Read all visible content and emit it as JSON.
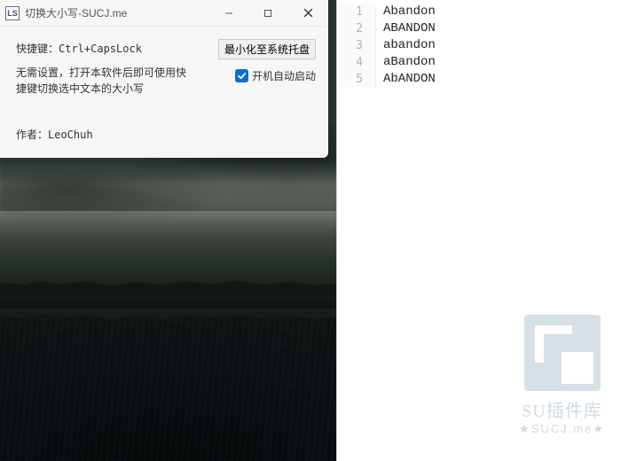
{
  "window": {
    "title": "切换大小写-SUCJ.me",
    "icon_glyph": "LS"
  },
  "body": {
    "hotkey_label": "快捷键：Ctrl+CapsLock",
    "tray_button": "最小化至系统托盘",
    "description_line1": "无需设置，打开本软件后即可使用快",
    "description_line2": "捷键切换选中文本的大小写",
    "autostart_label": "开机自动启动",
    "autostart_checked": true,
    "author": "作者：LeoChuh"
  },
  "editor": {
    "lines": [
      {
        "num": "1",
        "text": "Abandon"
      },
      {
        "num": "2",
        "text": "ABANDON"
      },
      {
        "num": "3",
        "text": "abandon"
      },
      {
        "num": "4",
        "text": "aBandon"
      },
      {
        "num": "5",
        "text": "AbANDON"
      }
    ]
  },
  "watermark": {
    "line1": "SU插件库",
    "line2": "★SUCJ.me★"
  }
}
